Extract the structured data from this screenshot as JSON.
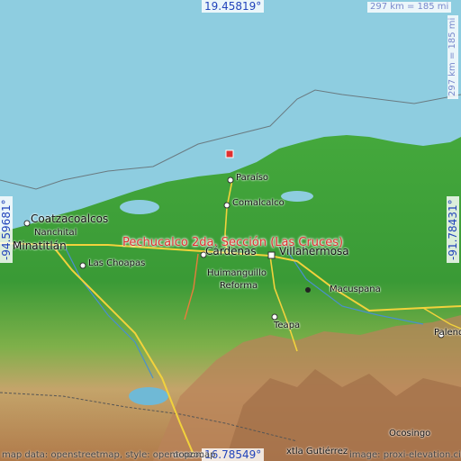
{
  "marker": {
    "name": "Pechucalco 2da. Sección (Las Cruces)"
  },
  "coords": {
    "top": "19.45819°",
    "bottom": "16.78549°",
    "left": "-94.59681°",
    "right": "-91.78431°"
  },
  "scale": {
    "horizontal": "297 km = 185 mi",
    "vertical": "297 km = 185 mi"
  },
  "cities": {
    "coatzacoalcos": "Coatzacoalcos",
    "nanchital": "Nanchital",
    "minatitlan": "Minatitlán",
    "las_choapas": "Las Choapas",
    "paraiso": "Paraíso",
    "comalcalco": "Comalcalco",
    "cardenas": "Cárdenas",
    "villahermosa": "Villahermosa",
    "humanguillo": "Huimanguillo",
    "reforma": "Reforma",
    "macuspana": "Macuspana",
    "teapa": "Teapa",
    "palenque": "Palenq",
    "ocosingo": "Ocosingo",
    "tuxtla": "xtla Gutiérrez",
    "ocozocoautla": "ocozoc"
  },
  "credits": {
    "left": "map data: openstreetmap, style: opentopomap",
    "right": "image: proxi-elevation.city"
  },
  "colors": {
    "sea": "#8ecde0",
    "lowland": "#3f9e3a",
    "highland": "#c98a5a",
    "marker": "#e03030",
    "coord_text": "#2244bb"
  }
}
